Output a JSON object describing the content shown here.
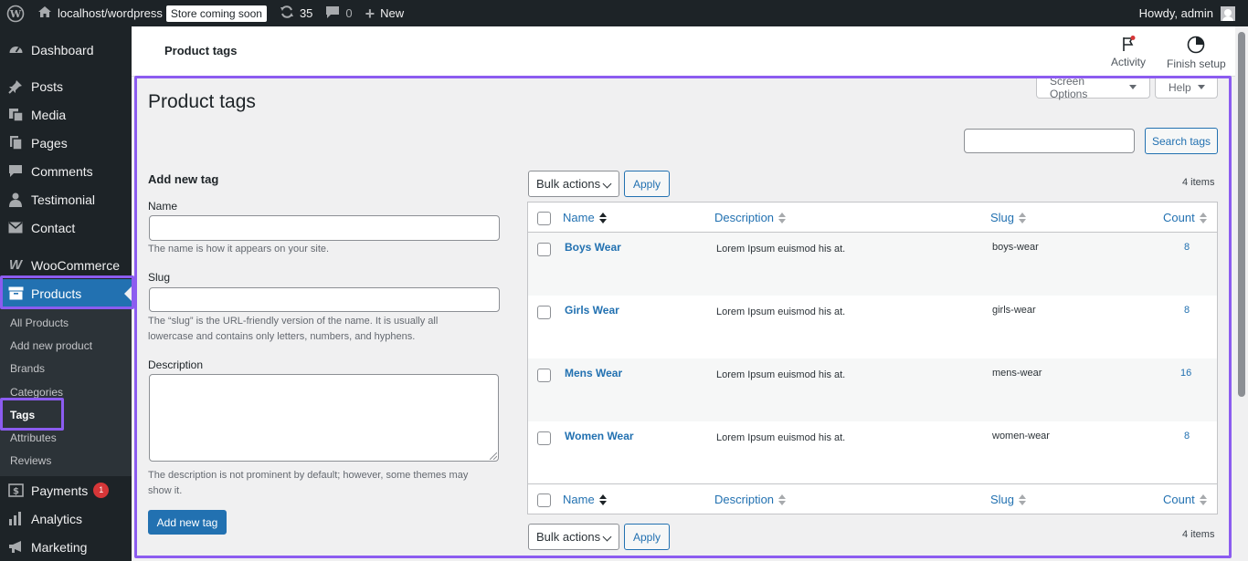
{
  "adminbar": {
    "site": "localhost/wordpress",
    "store_badge": "Store coming soon",
    "updates": "35",
    "comments": "0",
    "new": "New",
    "howdy": "Howdy, admin"
  },
  "sidebar": {
    "dashboard": "Dashboard",
    "posts": "Posts",
    "media": "Media",
    "pages": "Pages",
    "comments": "Comments",
    "testimonial": "Testimonial",
    "contact": "Contact",
    "woocommerce": "WooCommerce",
    "products": "Products",
    "sub": [
      "All Products",
      "Add new product",
      "Brands",
      "Categories",
      "Tags",
      "Attributes",
      "Reviews"
    ],
    "payments": "Payments",
    "payments_count": "1",
    "analytics": "Analytics",
    "marketing": "Marketing"
  },
  "wcheader": {
    "title": "Product tags",
    "activity": "Activity",
    "finish_setup": "Finish setup"
  },
  "page": {
    "heading": "Product tags",
    "screen_options": "Screen Options",
    "help": "Help",
    "search_button": "Search tags"
  },
  "form": {
    "heading": "Add new tag",
    "name_label": "Name",
    "name_desc": "The name is how it appears on your site.",
    "slug_label": "Slug",
    "slug_desc_1": "The “slug” is the URL-friendly version of the name. It is usually all",
    "slug_desc_2": "lowercase and contains only letters, numbers, and hyphens.",
    "description_label": "Description",
    "description_desc_1": "The description is not prominent by default; however, some themes may",
    "description_desc_2": "show it.",
    "submit": "Add new tag"
  },
  "table": {
    "bulk_actions": "Bulk actions",
    "apply": "Apply",
    "items": "4 items",
    "columns": {
      "name": "Name",
      "description": "Description",
      "slug": "Slug",
      "count": "Count"
    },
    "rows": [
      {
        "name": "Boys Wear",
        "description": "Lorem Ipsum euismod his at.",
        "slug": "boys-wear",
        "count": "8"
      },
      {
        "name": "Girls Wear",
        "description": "Lorem Ipsum euismod his at.",
        "slug": "girls-wear",
        "count": "8"
      },
      {
        "name": "Mens Wear",
        "description": "Lorem Ipsum euismod his at.",
        "slug": "mens-wear",
        "count": "16"
      },
      {
        "name": "Women Wear",
        "description": "Lorem Ipsum euismod his at.",
        "slug": "women-wear",
        "count": "8"
      }
    ]
  },
  "colors": {
    "accent": "#2271b1",
    "highlight": "#8c5cf0",
    "adminbar": "#1d2327"
  }
}
